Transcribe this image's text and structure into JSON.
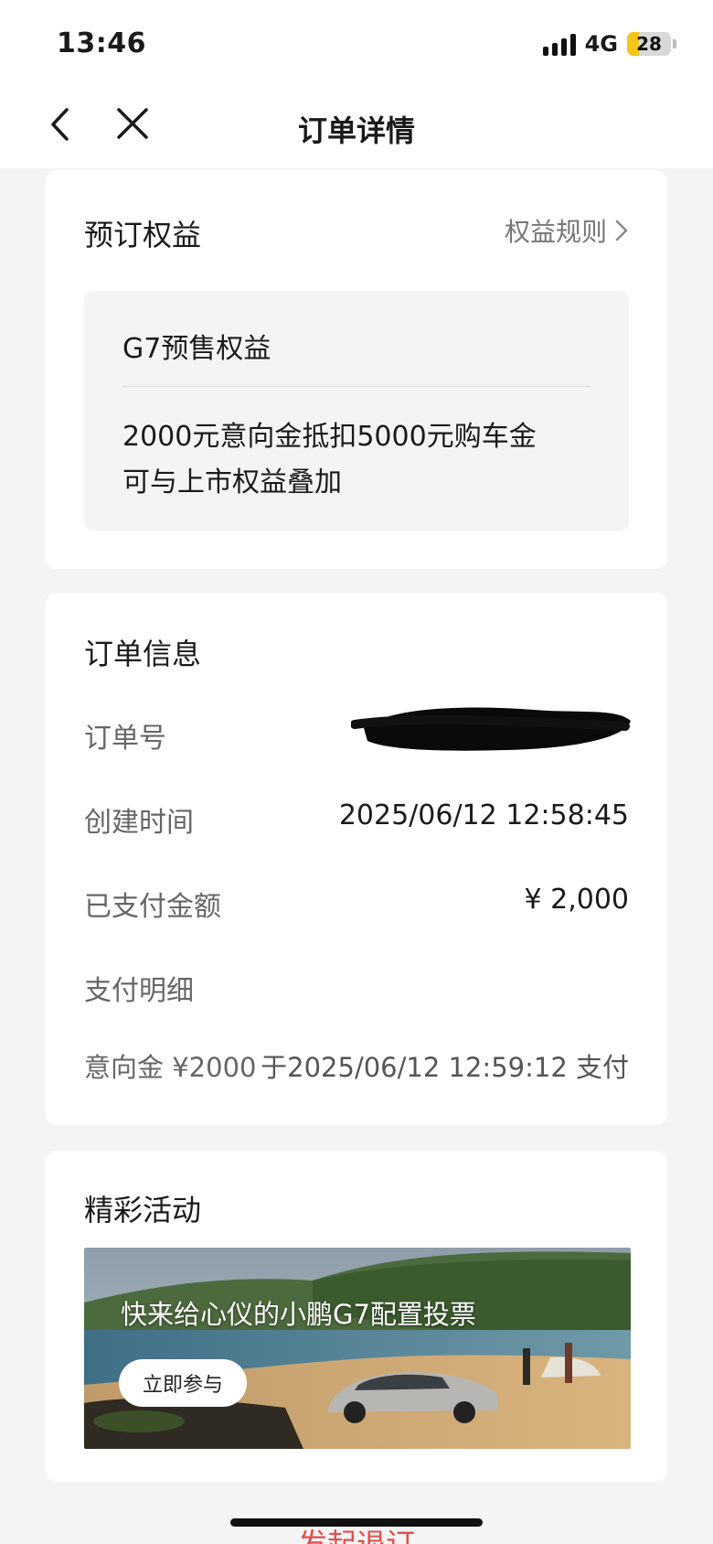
{
  "status_bar": {
    "time": "13:46",
    "network": "4G",
    "battery": "28",
    "battery_level": 0.28
  },
  "nav": {
    "back_icon": "chevron-left-icon",
    "close_icon": "close-icon",
    "title": "订单详情"
  },
  "benefits": {
    "title": "预订权益",
    "rules_label": "权益规则",
    "item_name": "G7预售权益",
    "line1": "2000元意向金抵扣5000元购车金",
    "line2": "可与上市权益叠加"
  },
  "order": {
    "title": "订单信息",
    "rows": [
      {
        "label": "订单号",
        "value": ""
      },
      {
        "label": "创建时间",
        "value": "2025/06/12 12:58:45"
      },
      {
        "label": "已支付金额",
        "value": "¥ 2,000"
      },
      {
        "label": "支付明细",
        "value": ""
      },
      {
        "label": "意向金 ¥2000",
        "value": "于2025/06/12 12:59:12 支付"
      }
    ]
  },
  "activity": {
    "title": "精彩活动",
    "banner_text": "快来给心仪的小鹏G7配置投票",
    "banner_button": "立即参与"
  },
  "bottom_action": "发起退订",
  "colors": {
    "accent_red": "#e54b4b",
    "battery_yellow": "#f5c518"
  }
}
